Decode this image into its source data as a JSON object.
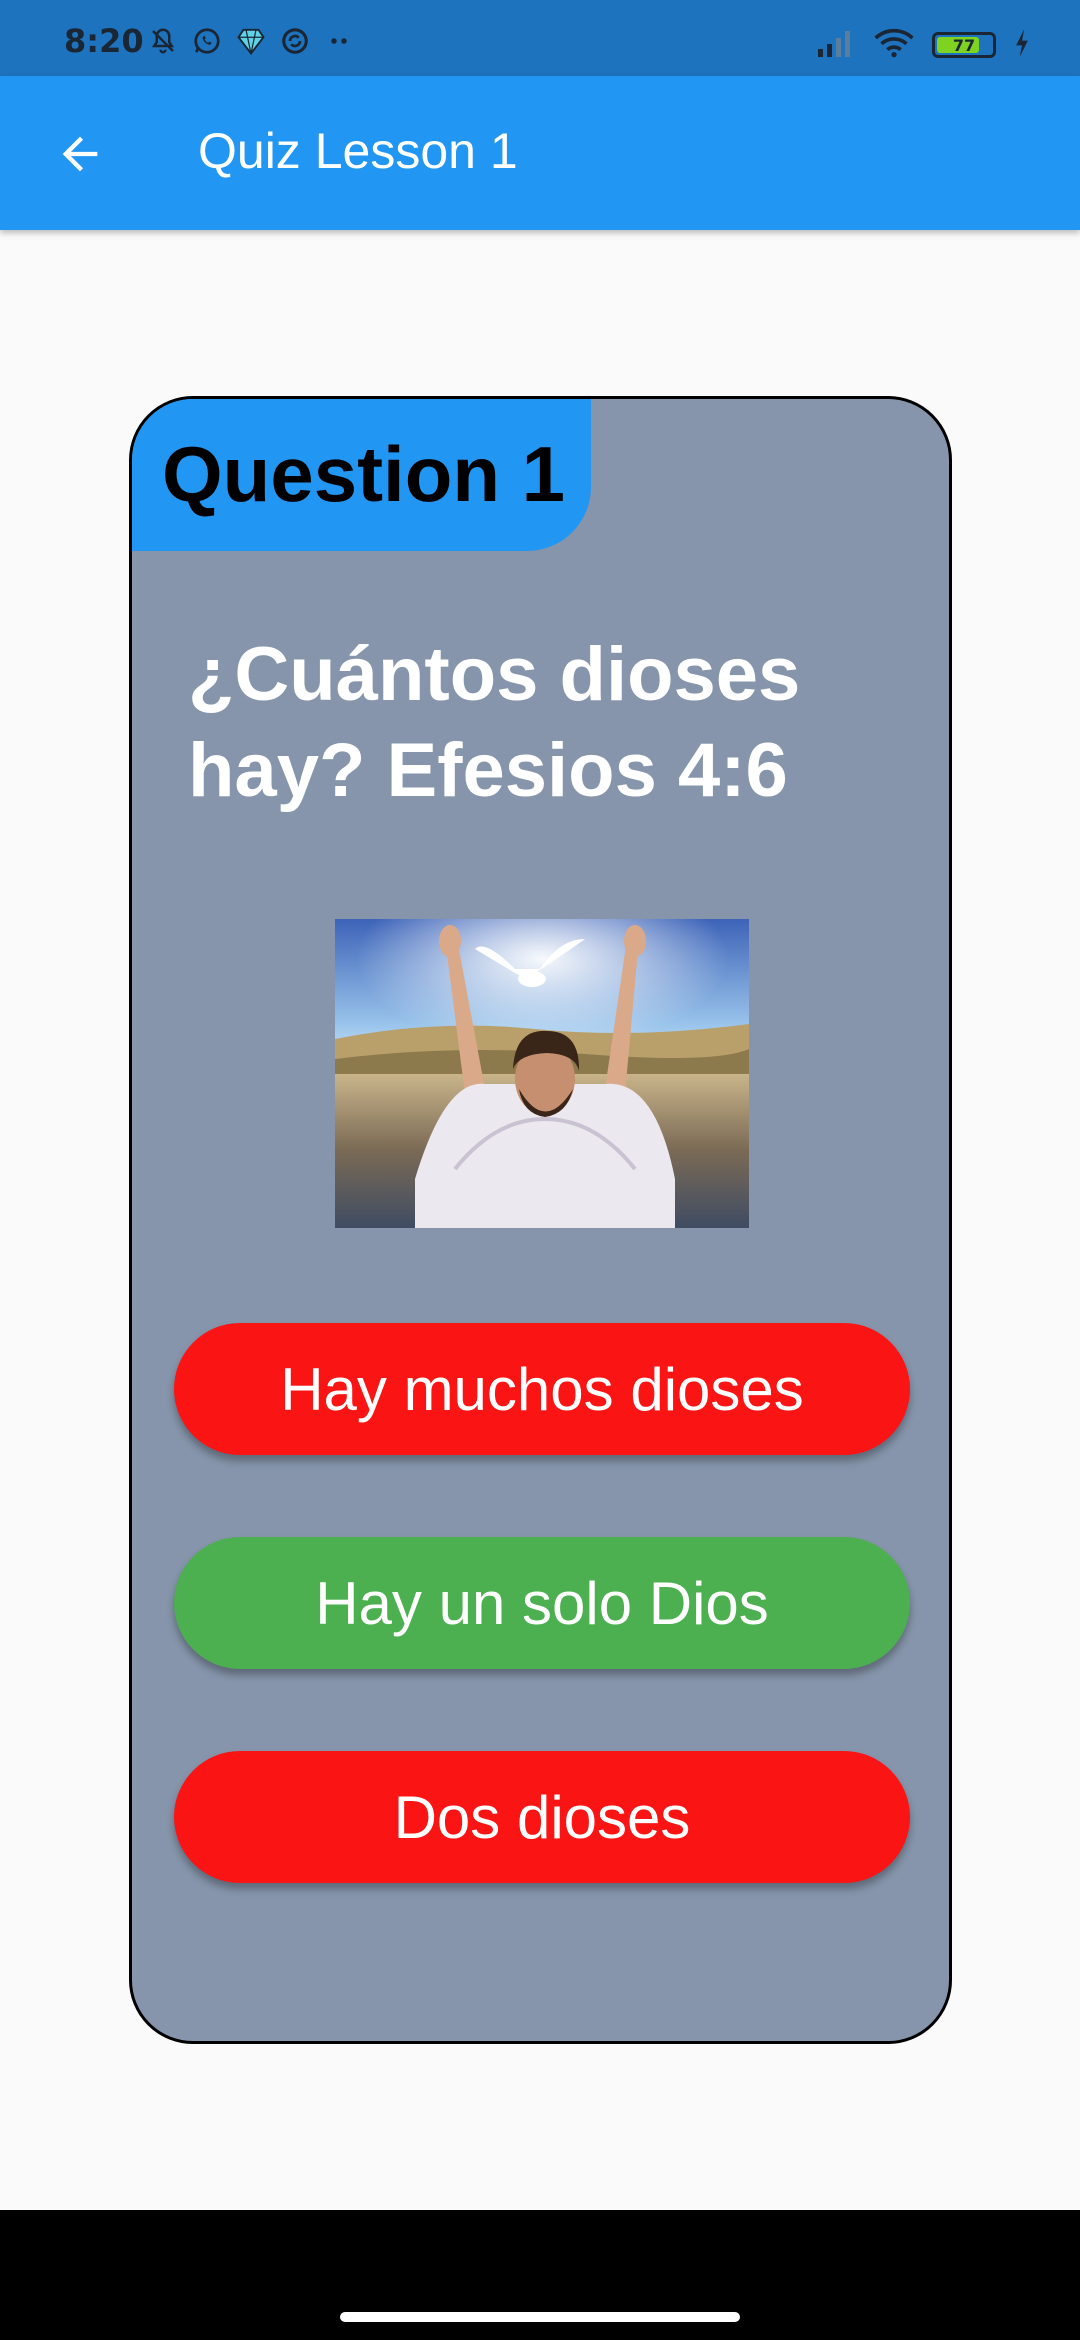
{
  "status_bar": {
    "time": "8:20",
    "battery_level": "77",
    "battery_fraction": 0.77,
    "icons_left": [
      "mute-icon",
      "whatsapp-icon",
      "gem-icon",
      "sync-icon",
      "more-notifications-icon"
    ],
    "icons_right": [
      "signal-icon",
      "wifi-icon",
      "battery-icon",
      "charging-icon"
    ]
  },
  "app_bar": {
    "title": "Quiz Lesson 1",
    "back_icon": "arrow-back-icon"
  },
  "quiz": {
    "question_label": "Question 1",
    "question_text": "¿Cuántos dioses hay? Efesios 4:6",
    "answers": [
      {
        "label": "Hay muchos dioses",
        "color": "#fa1414"
      },
      {
        "label": "Hay un solo Dios",
        "color": "#4caf50"
      },
      {
        "label": "Dos dioses",
        "color": "#fa1414"
      }
    ]
  },
  "colors": {
    "app_bar": "#2196f3",
    "status_bar": "#1e73be",
    "card_background": "#8695ab",
    "correct": "#4caf50",
    "incorrect": "#fa1414"
  }
}
